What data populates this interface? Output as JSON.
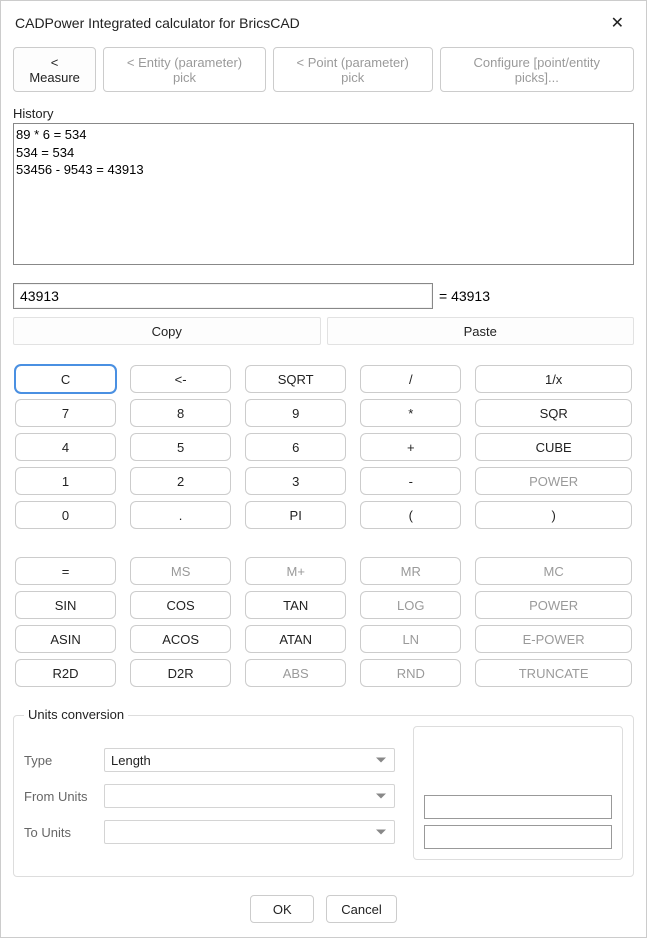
{
  "window": {
    "title": "CADPower Integrated calculator for BricsCAD"
  },
  "topbar": {
    "measure": "< Measure",
    "entity_pick": "< Entity (parameter) pick",
    "point_pick": "< Point (parameter) pick",
    "configure": "Configure [point/entity picks]..."
  },
  "history": {
    "label": "History",
    "text": "89 * 6 = 534\n534 = 534\n53456 - 9543 = 43913"
  },
  "input": {
    "value": "43913",
    "result_prefix": "= ",
    "result": "43913"
  },
  "clipboard": {
    "copy": "Copy",
    "paste": "Paste"
  },
  "keys": {
    "col1": [
      "C",
      "7",
      "4",
      "1",
      "0"
    ],
    "col2": [
      "<-",
      "8",
      "5",
      "2",
      "."
    ],
    "col3": [
      "SQRT",
      "9",
      "6",
      "3",
      "PI"
    ],
    "col4": [
      "/",
      "*",
      "+",
      "-",
      "("
    ],
    "col5": [
      "1/x",
      "SQR",
      "CUBE",
      "POWER",
      ")"
    ],
    "row7": {
      "c1": "=",
      "c2": "MS",
      "c3": "M+",
      "c4": "MR",
      "c5": "MC"
    },
    "row8": {
      "c1": "SIN",
      "c2": "COS",
      "c3": "TAN",
      "c4": "LOG",
      "c5": "POWER"
    },
    "row9": {
      "c1": "ASIN",
      "c2": "ACOS",
      "c3": "ATAN",
      "c4": "LN",
      "c5": "E-POWER"
    },
    "row10": {
      "c1": "R2D",
      "c2": "D2R",
      "c3": "ABS",
      "c4": "RND",
      "c5": "TRUNCATE"
    }
  },
  "units": {
    "title": "Units conversion",
    "type_label": "Type",
    "type_value": "Length",
    "from_label": "From Units",
    "to_label": "To Units"
  },
  "footer": {
    "ok": "OK",
    "cancel": "Cancel"
  }
}
